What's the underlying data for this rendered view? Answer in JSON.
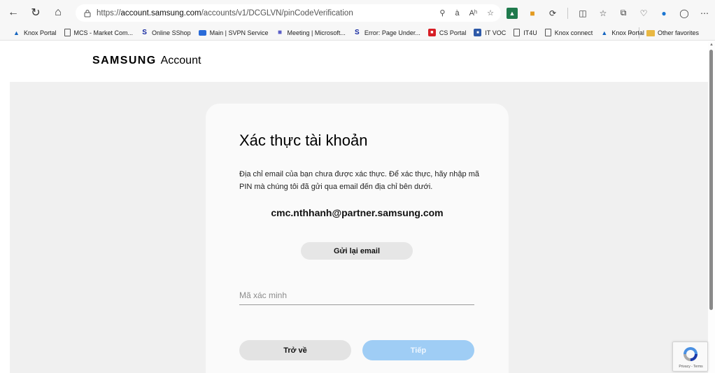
{
  "browser": {
    "url_prefix": "https://",
    "url_domain": "account.samsung.com",
    "url_path": "/accounts/v1/DCGLVN/pinCodeVerification",
    "read_aloud_label": "à",
    "immersive_label": "Aʰ"
  },
  "bookmarks": {
    "items": [
      {
        "label": "Knox Portal",
        "icon": "knox-icon"
      },
      {
        "label": "MCS - Market Com...",
        "icon": "page-icon"
      },
      {
        "label": "Online SShop",
        "icon": "samsung-s-icon"
      },
      {
        "label": "Main | SVPN Service",
        "icon": "svpn-icon"
      },
      {
        "label": "Meeting | Microsoft...",
        "icon": "teams-icon"
      },
      {
        "label": "Error: Page Under...",
        "icon": "samsung-s-icon"
      },
      {
        "label": "CS Portal",
        "icon": "cs-portal-icon"
      },
      {
        "label": "IT VOC",
        "icon": "it-voc-icon"
      },
      {
        "label": "IT4U",
        "icon": "page-icon"
      },
      {
        "label": "Knox connect",
        "icon": "page-icon"
      },
      {
        "label": "Knox Portal",
        "icon": "knox-icon"
      }
    ],
    "other_favorites": "Other favorites"
  },
  "header": {
    "brand_samsung": "SAMSUNG",
    "brand_account": "Account"
  },
  "card": {
    "title": "Xác thực tài khoản",
    "description": "Địa chỉ email của bạn chưa được xác thực. Để xác thực, hãy nhập mã PIN mà chúng tôi đã gửi qua email đến địa chỉ bên dưới.",
    "email": "cmc.nthhanh@partner.samsung.com",
    "resend_label": "Gửi lại email",
    "pin_placeholder": "Mã xác minh",
    "back_label": "Trở về",
    "next_label": "Tiếp"
  },
  "recaptcha": {
    "terms": "Privacy - Terms"
  },
  "colors": {
    "page_bg": "#f0f0f0",
    "card_bg": "#fafafa",
    "next_button": "#9fcdf5",
    "secondary_button": "#e3e3e3"
  }
}
